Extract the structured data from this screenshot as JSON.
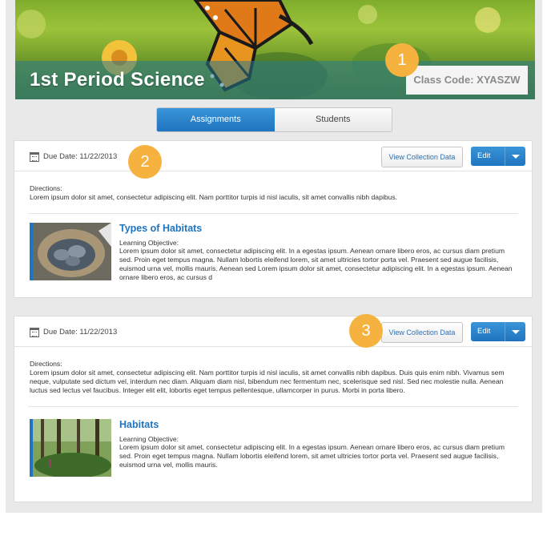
{
  "banner": {
    "title": "1st Period Science",
    "class_code": "Class Code: XYASZW"
  },
  "markers": [
    "1",
    "2",
    "3"
  ],
  "tabs": [
    {
      "label": "Assignments",
      "active": true
    },
    {
      "label": "Students",
      "active": false
    }
  ],
  "assignments": [
    {
      "due": "Due Date: 11/22/2013",
      "view_button": "View Collection Data",
      "edit_button": "Edit",
      "directions_label": "Directions:",
      "directions_text": "Lorem ipsum dolor sit amet, consectetur adipiscing elit. Nam porttitor turpis id nisl iaculis, sit amet convallis nibh dapibus.",
      "resource": {
        "title": "Types of Habitats",
        "objective_label": "Learning Objective:",
        "objective_text": "Lorem ipsum dolor sit amet, consectetur adipiscing elit. In a egestas ipsum. Aenean ornare libero eros, ac cursus diam pretium sed. Proin eget tempus magna. Nullam lobortis eleifend lorem, sit amet ultricies tortor porta vel. Praesent sed augue facilisis, euismod urna vel, mollis mauris. Aenean sed Lorem ipsum dolor sit amet, consectetur adipiscing elit. In a egestas ipsum. Aenean ornare libero eros, ac cursus d"
      }
    },
    {
      "due": "Due Date: 11/22/2013",
      "view_button": "View Collection Data",
      "edit_button": "Edit",
      "directions_label": "Directions:",
      "directions_text": "Lorem ipsum dolor sit amet, consectetur adipiscing elit. Nam porttitor turpis id nisl iaculis, sit amet convallis nibh dapibus. Duis quis enim nibh. Vivamus sem neque, vulputate sed dictum vel, interdum nec diam. Aliquam diam nisl, bibendum nec fermentum nec, scelerisque sed nisl. Sed nec molestie nulla. Aenean luctus sed lectus vel faucibus. Integer elit elit, lobortis eget tempus pellentesque, ullamcorper in purus. Morbi in porta libero.",
      "resource": {
        "title": "Habitats",
        "objective_label": "Learning Objective:",
        "objective_text": "Lorem ipsum dolor sit amet, consectetur adipiscing elit. In a egestas ipsum. Aenean ornare libero eros, ac cursus diam pretium sed. Proin eget tempus magna. Nullam lobortis eleifend lorem, sit amet ultricies tortor porta vel. Praesent sed augue facilisis, euismod urna vel, mollis mauris."
      }
    }
  ],
  "colors": {
    "accent": "#1f74bf",
    "marker": "#f6b23e"
  },
  "icons": [
    "calendar-icon",
    "chevron-down-icon"
  ]
}
